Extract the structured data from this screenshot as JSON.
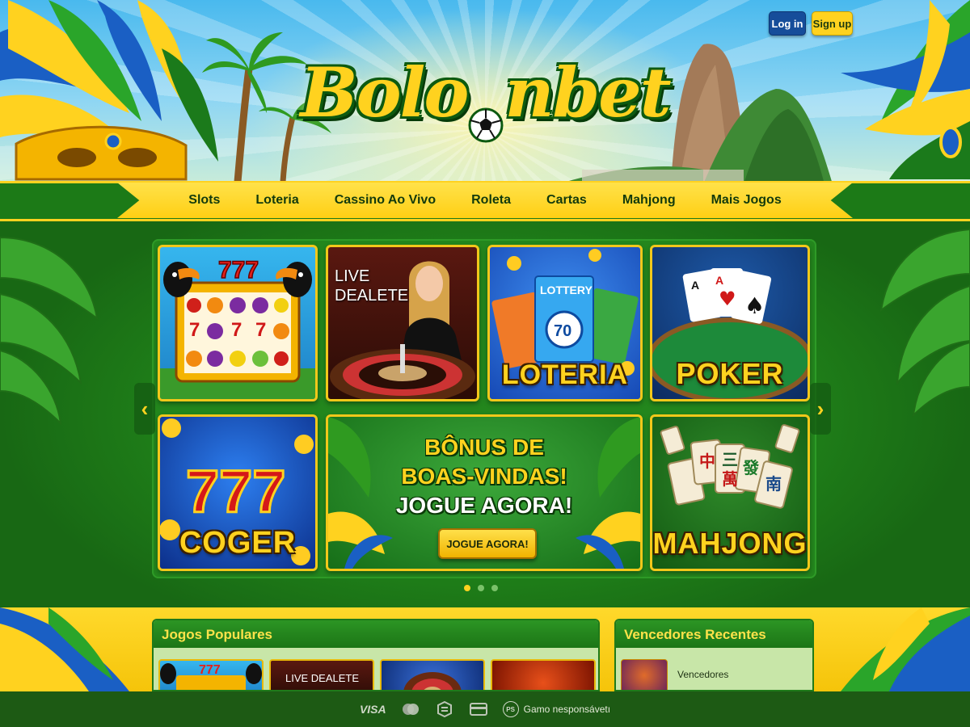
{
  "brand": {
    "logo_text_left": "Bolo",
    "logo_text_right": "nbet"
  },
  "auth": {
    "login_label": "Log in",
    "signup_label": "Sign up"
  },
  "nav": {
    "items": [
      {
        "label": "Slots"
      },
      {
        "label": "Loteria"
      },
      {
        "label": "Cassino Ao Vivo"
      },
      {
        "label": "Roleta"
      },
      {
        "label": "Cartas"
      },
      {
        "label": "Mahjong"
      },
      {
        "label": "Mais Jogos"
      }
    ]
  },
  "games": {
    "slots": {
      "label": "777",
      "icon": "toucan-slot-machine"
    },
    "live": {
      "title": "LIVE DEALETE"
    },
    "lottery": {
      "label": "LOTERIA",
      "ticket_label": "LOTTERY",
      "ticket_number": "70"
    },
    "poker": {
      "label": "POKER"
    },
    "coger": {
      "label": "COGER",
      "sublabel": "777"
    },
    "mahjong": {
      "label": "MAHJONG"
    }
  },
  "promo": {
    "line1": "BÔNUS DE",
    "line2": "BOAS-VINDAS!",
    "line3": "JOGUE AGORA!",
    "button_label": "JOGUE AGORA!"
  },
  "carousel": {
    "slide_count": 3,
    "active_index": 0
  },
  "sections": {
    "popular": {
      "title": "Jogos Populares",
      "live_thumb_text": "LIVE DEALETE",
      "slot_thumb_text": "777"
    },
    "winners": {
      "title": "Vencedores Recentes",
      "entry_label": "Vencedores"
    }
  },
  "footer": {
    "payments": [
      "VISA",
      "mastercard-icon",
      "crypto-icon",
      "card-icon"
    ],
    "responsible_badge": "PS",
    "responsible_text": "Gamo nesponsávetı"
  },
  "colors": {
    "brand_green": "#1f7a1a",
    "brand_yellow": "#ffd21f",
    "login_blue": "#164d9a",
    "footer_green": "#1d5a14"
  }
}
